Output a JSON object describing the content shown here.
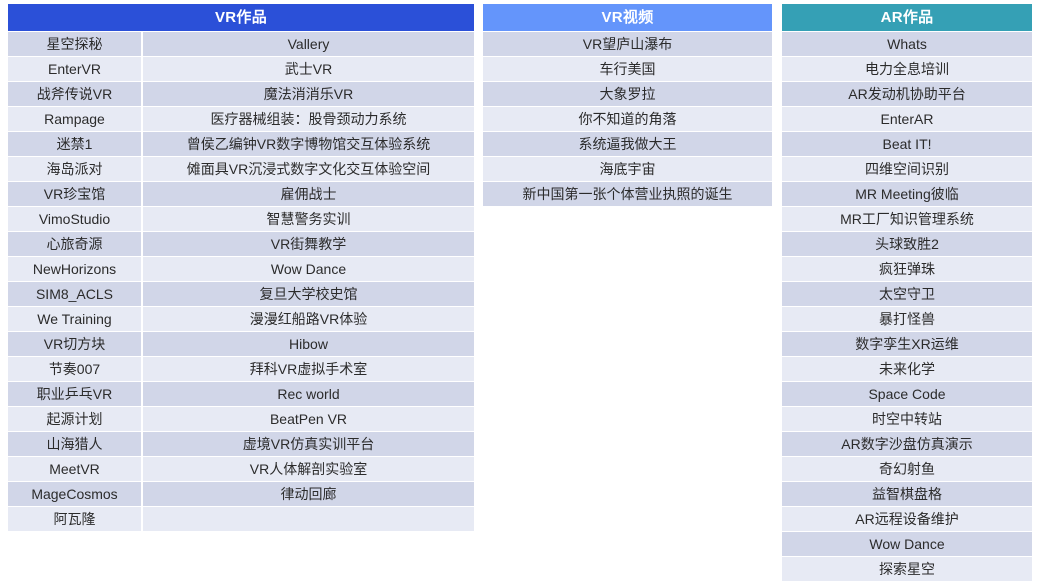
{
  "page": {
    "background_color": "#ffffff",
    "row_color_odd": "#d1d6e8",
    "row_color_even": "#e7eaf4",
    "text_color": "#2b2b2b"
  },
  "tables": [
    {
      "id": "vr-works",
      "title": "VR作品",
      "header_color": "#2b50d8",
      "columns": 2,
      "rows": [
        [
          "星空探秘",
          "Vallery"
        ],
        [
          "EnterVR",
          "武士VR"
        ],
        [
          "战斧传说VR",
          "魔法消消乐VR"
        ],
        [
          "Rampage",
          "医疗器械组装：股骨颈动力系统"
        ],
        [
          "迷禁1",
          "曾侯乙编钟VR数字博物馆交互体验系统"
        ],
        [
          "海岛派对",
          "傩面具VR沉浸式数字文化交互体验空间"
        ],
        [
          "VR珍宝馆",
          "雇佣战士"
        ],
        [
          "VimoStudio",
          "智慧警务实训"
        ],
        [
          "心旅奇源",
          "VR街舞教学"
        ],
        [
          "NewHorizons",
          "Wow Dance"
        ],
        [
          "SIM8_ACLS",
          "复旦大学校史馆"
        ],
        [
          "We Training",
          "漫漫红船路VR体验"
        ],
        [
          "VR切方块",
          "Hibow"
        ],
        [
          "节奏007",
          "拜科VR虚拟手术室"
        ],
        [
          "职业乒乓VR",
          "Rec world"
        ],
        [
          "起源计划",
          "BeatPen VR"
        ],
        [
          "山海猎人",
          "虚境VR仿真实训平台"
        ],
        [
          "MeetVR",
          "VR人体解剖实验室"
        ],
        [
          "MageCosmos",
          "律动回廊"
        ],
        [
          "阿瓦隆",
          ""
        ]
      ]
    },
    {
      "id": "vr-videos",
      "title": "VR视频",
      "header_color": "#6495fb",
      "columns": 1,
      "rows": [
        [
          "VR望庐山瀑布"
        ],
        [
          "车行美国"
        ],
        [
          "大象罗拉"
        ],
        [
          "你不知道的角落"
        ],
        [
          "系统逼我做大王"
        ],
        [
          "海底宇宙"
        ],
        [
          "新中国第一张个体营业执照的诞生"
        ]
      ]
    },
    {
      "id": "ar-works",
      "title": "AR作品",
      "header_color": "#35a0b5",
      "columns": 1,
      "rows": [
        [
          "Whats"
        ],
        [
          "电力全息培训"
        ],
        [
          "AR发动机协助平台"
        ],
        [
          "EnterAR"
        ],
        [
          "Beat IT!"
        ],
        [
          "四维空间识别"
        ],
        [
          "MR Meeting彼临"
        ],
        [
          "MR工厂知识管理系统"
        ],
        [
          "头球致胜2"
        ],
        [
          "疯狂弹珠"
        ],
        [
          "太空守卫"
        ],
        [
          "暴打怪兽"
        ],
        [
          "数字孪生XR运维"
        ],
        [
          "未来化学"
        ],
        [
          "Space Code"
        ],
        [
          "时空中转站"
        ],
        [
          "AR数字沙盘仿真演示"
        ],
        [
          "奇幻射鱼"
        ],
        [
          "益智棋盘格"
        ],
        [
          "AR远程设备维护"
        ],
        [
          "Wow Dance"
        ],
        [
          "探索星空"
        ]
      ]
    }
  ]
}
